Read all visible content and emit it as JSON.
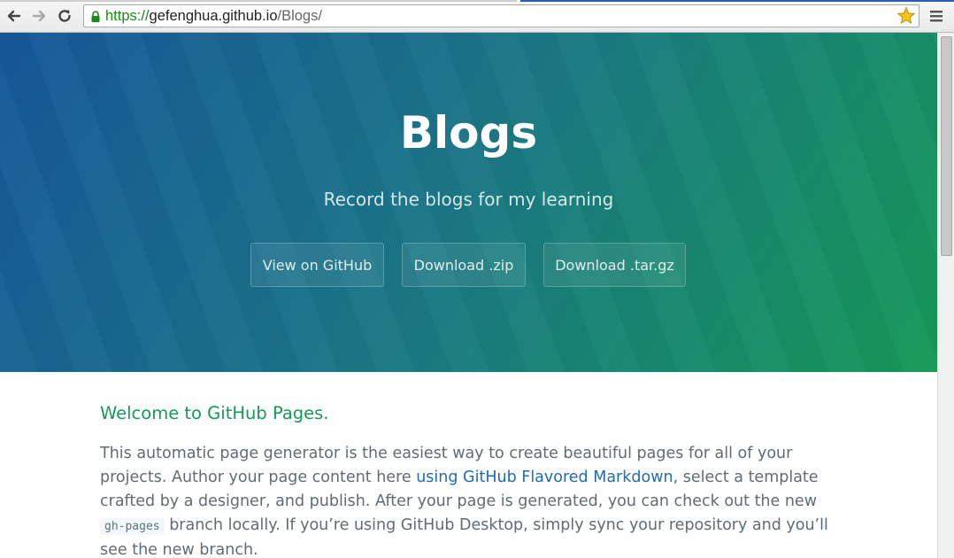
{
  "browser": {
    "url_scheme": "https://",
    "url_host": "gefenghua.github.io",
    "url_path": "/Blogs/",
    "icons": {
      "back": "back-arrow-icon",
      "forward": "forward-arrow-icon",
      "reload": "reload-icon",
      "lock": "lock-icon",
      "bookmark": "star-icon",
      "menu": "hamburger-menu-icon"
    },
    "colors": {
      "secure": "#1b8a1b",
      "bookmark_star": "#f5c518"
    }
  },
  "hero": {
    "title": "Blogs",
    "tagline": "Record the blogs for my learning",
    "buttons": [
      "View on GitHub",
      "Download .zip",
      "Download .tar.gz"
    ],
    "colors": {
      "gradient_start": "#155799",
      "gradient_end": "#159957"
    }
  },
  "main": {
    "heading": "Welcome to GitHub Pages.",
    "paragraph": {
      "part1": "This automatic page generator is the easiest way to create beautiful pages for all of your projects. Author your page content here ",
      "link_text": "using GitHub Flavored Markdown",
      "part2": ", select a template crafted by a designer, and publish. After your page is generated, you can check out the new ",
      "code": "gh-pages",
      "part3": " branch locally. If you’re using GitHub Desktop, simply sync your repository and you’ll see the new branch."
    },
    "colors": {
      "heading": "#159957",
      "link": "#1e6bb8",
      "text": "#606c71"
    }
  }
}
